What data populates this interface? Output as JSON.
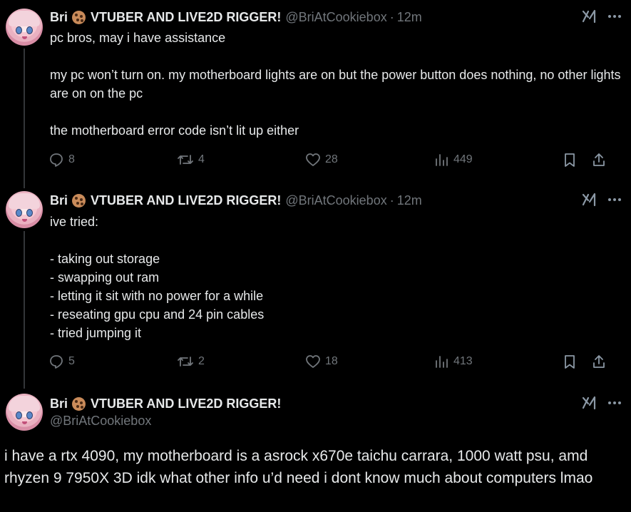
{
  "tweets": [
    {
      "author_name_pre": "Bri",
      "author_name_post": "VTUBER AND LIVE2D RIGGER!",
      "handle": "@BriAtCookiebox",
      "separator": "·",
      "time": "12m",
      "paragraphs": [
        "pc bros, may i have assistance",
        "my pc won’t turn on. my motherboard lights are on but the power button does nothing, no other lights are on on the pc",
        "the motherboard error code isn’t lit up either"
      ],
      "replies": "8",
      "reposts": "4",
      "likes": "28",
      "views": "449"
    },
    {
      "author_name_pre": "Bri",
      "author_name_post": "VTUBER AND LIVE2D RIGGER!",
      "handle": "@BriAtCookiebox",
      "separator": "·",
      "time": "12m",
      "paragraphs": [
        "ive tried:",
        "- taking out storage\n- swapping out ram\n- letting it sit with no power for a while\n- reseating gpu cpu and 24 pin cables\n- tried jumping it"
      ],
      "replies": "5",
      "reposts": "2",
      "likes": "18",
      "views": "413"
    },
    {
      "author_name_pre": "Bri",
      "author_name_post": "VTUBER AND LIVE2D RIGGER!",
      "handle": "@BriAtCookiebox",
      "text": "i have a rtx 4090, my motherboard is a asrock x670e taichu carrara, 1000 watt psu, amd rhyzen 9 7950X 3D idk what other info u’d need i dont know much about computers lmao"
    }
  ],
  "icons": {
    "author_badge": "cookie-icon",
    "grok": "grok-icon",
    "more": "more-icon",
    "reply": "reply-icon",
    "repost": "repost-icon",
    "like": "heart-icon",
    "views": "views-icon",
    "bookmark": "bookmark-icon",
    "share": "share-icon"
  },
  "colors": {
    "background": "#000000",
    "text": "#e7e9ea",
    "muted": "#71767b",
    "thread_line": "#333639"
  }
}
